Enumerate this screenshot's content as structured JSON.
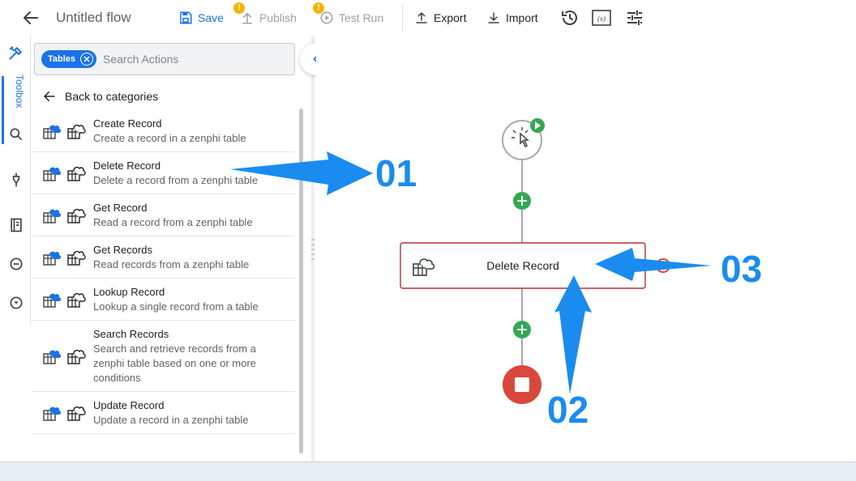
{
  "header": {
    "title": "Untitled flow",
    "save_label": "Save",
    "publish_label": "Publish",
    "testrun_label": "Test Run",
    "export_label": "Export",
    "import_label": "Import",
    "warn_mark": "!"
  },
  "rail": {
    "toolbox_label": "Toolbox",
    "accent_color": "#1a73e8"
  },
  "panel": {
    "search": {
      "chip_label": "Tables",
      "placeholder": "Search Actions"
    },
    "back_label": "Back to categories",
    "items": [
      {
        "title": "Create Record",
        "description": "Create a record in a zenphi table"
      },
      {
        "title": "Delete Record",
        "description": "Delete a record from a zenphi table"
      },
      {
        "title": "Get Record",
        "description": "Read a record from a zenphi table"
      },
      {
        "title": "Get Records",
        "description": "Read records from a zenphi table"
      },
      {
        "title": "Lookup Record",
        "description": "Lookup a single record from a table"
      },
      {
        "title": "Search Records",
        "description": "Search and retrieve records from a zenphi table based on one or more conditions"
      },
      {
        "title": "Update Record",
        "description": "Update a record in a zenphi table"
      }
    ]
  },
  "canvas": {
    "node_label": "Delete Record",
    "colors": {
      "node_border": "#b3303a",
      "add_button": "#34a853",
      "stop_node": "#d9473d",
      "annotation": "#1a8cf0"
    }
  },
  "annotations": {
    "n1": "01",
    "n2": "02",
    "n3": "03"
  }
}
